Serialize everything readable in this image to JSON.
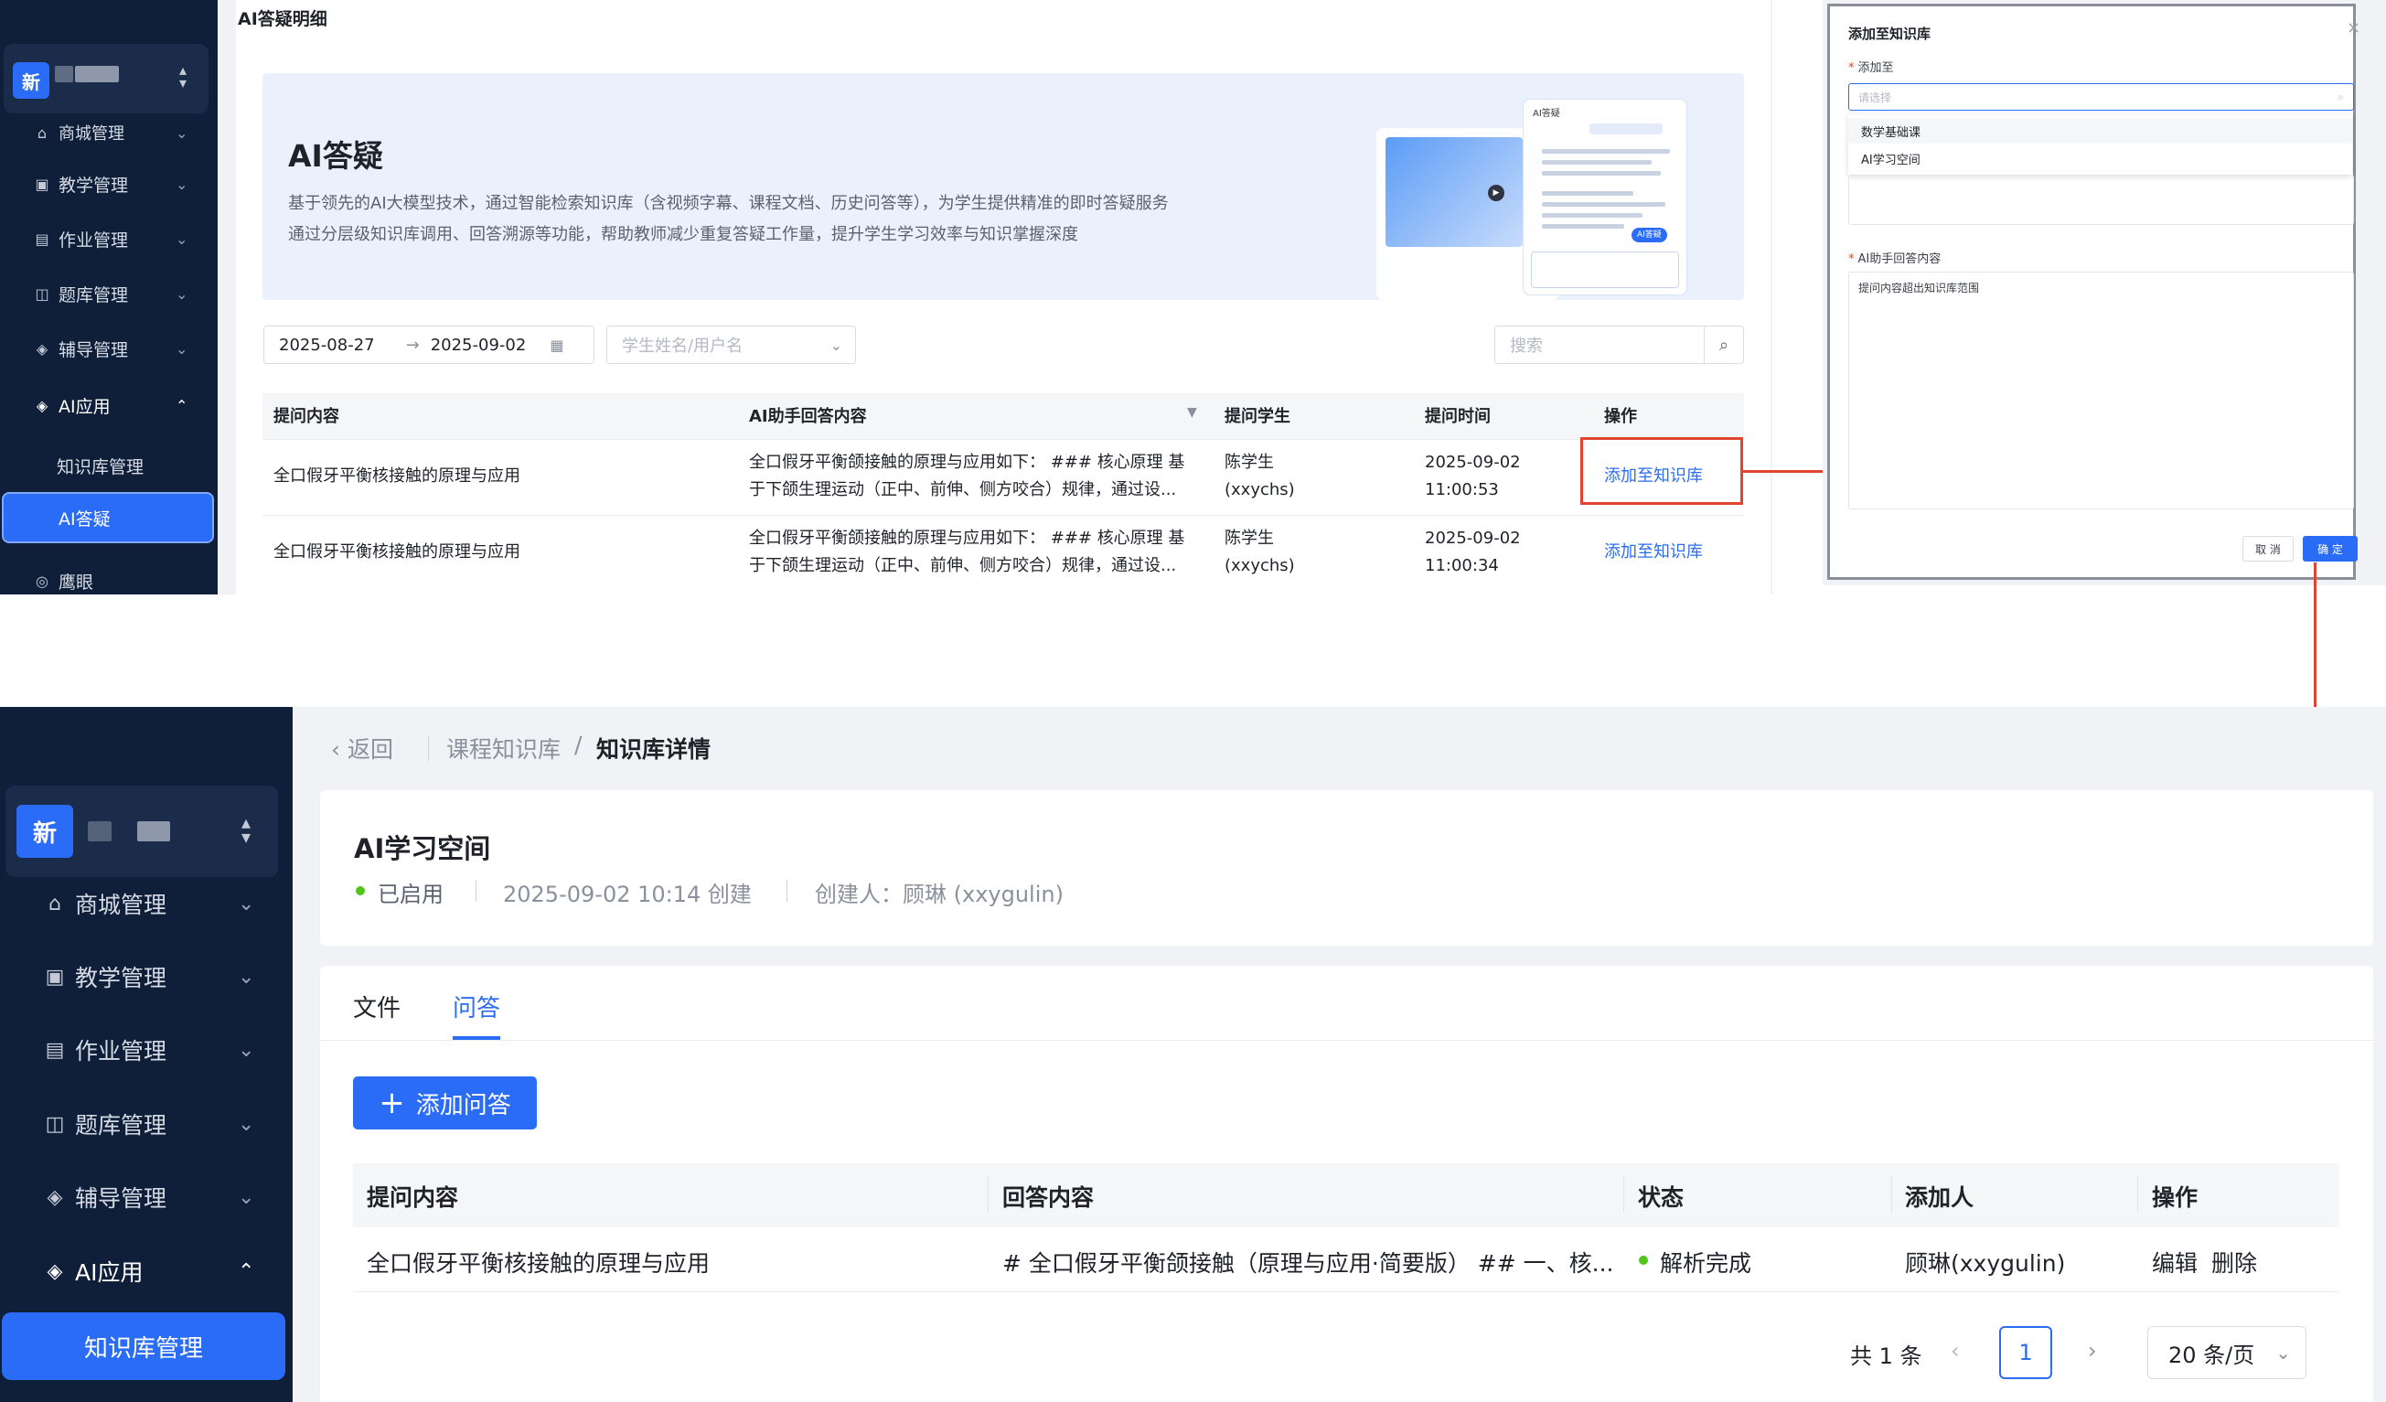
{
  "top_screen": {
    "sidebar": {
      "school_badge": "新",
      "items": [
        {
          "label": "商城管理"
        },
        {
          "label": "教学管理"
        },
        {
          "label": "作业管理"
        },
        {
          "label": "题库管理"
        },
        {
          "label": "辅导管理"
        },
        {
          "label": "AI应用"
        },
        {
          "label": "知识库管理"
        },
        {
          "label": "AI答疑"
        },
        {
          "label": "鹰眼"
        }
      ]
    },
    "page_title": "AI答疑明细",
    "banner": {
      "title": "AI答疑",
      "desc_line1": "基于领先的AI大模型技术，通过智能检索知识库（含视频字幕、课程文档、历史问答等），为学生提供精准的即时答疑服务",
      "desc_line2": "通过分层级知识库调用、回答溯源等功能，帮助教师减少重复答疑工作量，提升学生学习效率与知识掌握深度",
      "chat_header": "AI答疑",
      "chat_badge": "AI答疑"
    },
    "filters": {
      "date_start": "2025-08-27",
      "date_arrow": "→",
      "date_end": "2025-09-02",
      "student_placeholder": "学生姓名/用户名",
      "search_placeholder": "搜索"
    },
    "table": {
      "headers": [
        "提问内容",
        "AI助手回答内容",
        "提问学生",
        "提问时间",
        "操作"
      ],
      "rows": [
        {
          "question": "全口假牙平衡核接触的原理与应用",
          "answer_line1": "全口假牙平衡颌接触的原理与应用如下： ### 核心原理 基",
          "answer_line2": "于下颌生理运动（正中、前伸、侧方咬合）规律，通过设...",
          "student_line1": "陈学生",
          "student_line2": "(xxychs)",
          "time_line1": "2025-09-02",
          "time_line2": "11:00:53",
          "action": "添加至知识库"
        },
        {
          "question": "全口假牙平衡核接触的原理与应用",
          "answer_line1": "全口假牙平衡颌接触的原理与应用如下： ### 核心原理 基",
          "answer_line2": "于下颌生理运动（正中、前伸、侧方咬合）规律，通过设...",
          "student_line1": "陈学生",
          "student_line2": "(xxychs)",
          "time_line1": "2025-09-02",
          "time_line2": "11:00:34",
          "action": "添加至知识库"
        }
      ]
    }
  },
  "modal": {
    "title": "添加至知识库",
    "close": "×",
    "add_to_label": "添加至",
    "required_mark": "*",
    "select_placeholder": "请选择",
    "options": [
      "数学基础课",
      "AI学习空间"
    ],
    "answer_label": "AI助手回答内容",
    "answer_value": "提问内容超出知识库范围",
    "cancel": "取 消",
    "ok": "确 定"
  },
  "bottom_screen": {
    "sidebar": {
      "school_badge": "新",
      "items": [
        {
          "label": "商城管理"
        },
        {
          "label": "教学管理"
        },
        {
          "label": "作业管理"
        },
        {
          "label": "题库管理"
        },
        {
          "label": "辅导管理"
        },
        {
          "label": "AI应用"
        },
        {
          "label": "知识库管理"
        }
      ]
    },
    "breadcrumb": {
      "back": "返回",
      "parent": "课程知识库",
      "sep": "/",
      "current": "知识库详情"
    },
    "kb": {
      "name": "AI学习空间",
      "status": "已启用",
      "created": "2025-09-02 10:14 创建",
      "creator": "创建人：顾琳 (xxygulin)"
    },
    "tabs": [
      "文件",
      "问答"
    ],
    "add_button": "添加问答",
    "table": {
      "headers": [
        "提问内容",
        "回答内容",
        "状态",
        "添加人",
        "操作"
      ],
      "rows": [
        {
          "question": "全口假牙平衡核接触的原理与应用",
          "answer": "# 全口假牙平衡颌接触（原理与应用·简要版） ## 一、核...",
          "status": "解析完成",
          "adder": "顾琳(xxygulin)",
          "edit": "编辑",
          "delete": "删除"
        }
      ]
    },
    "pagination": {
      "total": "共 1 条",
      "page": "1",
      "page_size": "20 条/页"
    }
  },
  "colors": {
    "accent": "#2b6cf6",
    "sidebar_bg": "#0f1f3a",
    "arrow": "#e0462f",
    "status_ok": "#52c41a"
  }
}
